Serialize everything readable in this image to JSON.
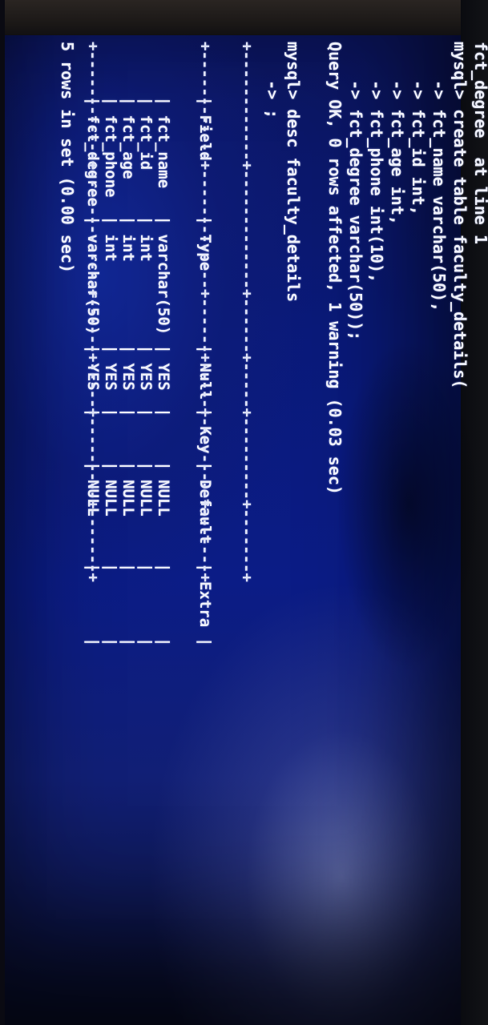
{
  "terminal": {
    "lines": [
      "fct_degree  at line 1",
      "mysql> create table faculty_details(",
      "    -> fct_name varchar(50),",
      "    -> fct_id int,",
      "    -> fct_age int,",
      "    -> fct_phone int(10),",
      "    -> fct_degree varchar(50));",
      "Query OK, 0 rows affected, 1 warning (0.03 sec)",
      "",
      "mysql> desc faculty_details",
      "    -> ;"
    ],
    "table": {
      "border": "+------------+-------------+------+-----+---------+-------+",
      "headers": [
        "Field",
        "Type",
        "Null",
        "Key",
        "Default",
        "Extra"
      ],
      "rows": [
        [
          "fct_name",
          "varchar(50)",
          "YES",
          "",
          "NULL",
          ""
        ],
        [
          "fct_id",
          "int",
          "YES",
          "",
          "NULL",
          ""
        ],
        [
          "fct_age",
          "int",
          "YES",
          "",
          "NULL",
          ""
        ],
        [
          "fct_phone",
          "int",
          "YES",
          "",
          "NULL",
          ""
        ],
        [
          "fct_degree",
          "varchar(50)",
          "YES",
          "",
          "NULL",
          ""
        ]
      ]
    },
    "footer": "5 rows in set (0.00 sec)"
  },
  "colors": {
    "screen_bg": "#0b1c86",
    "text": "#eef0fa"
  }
}
